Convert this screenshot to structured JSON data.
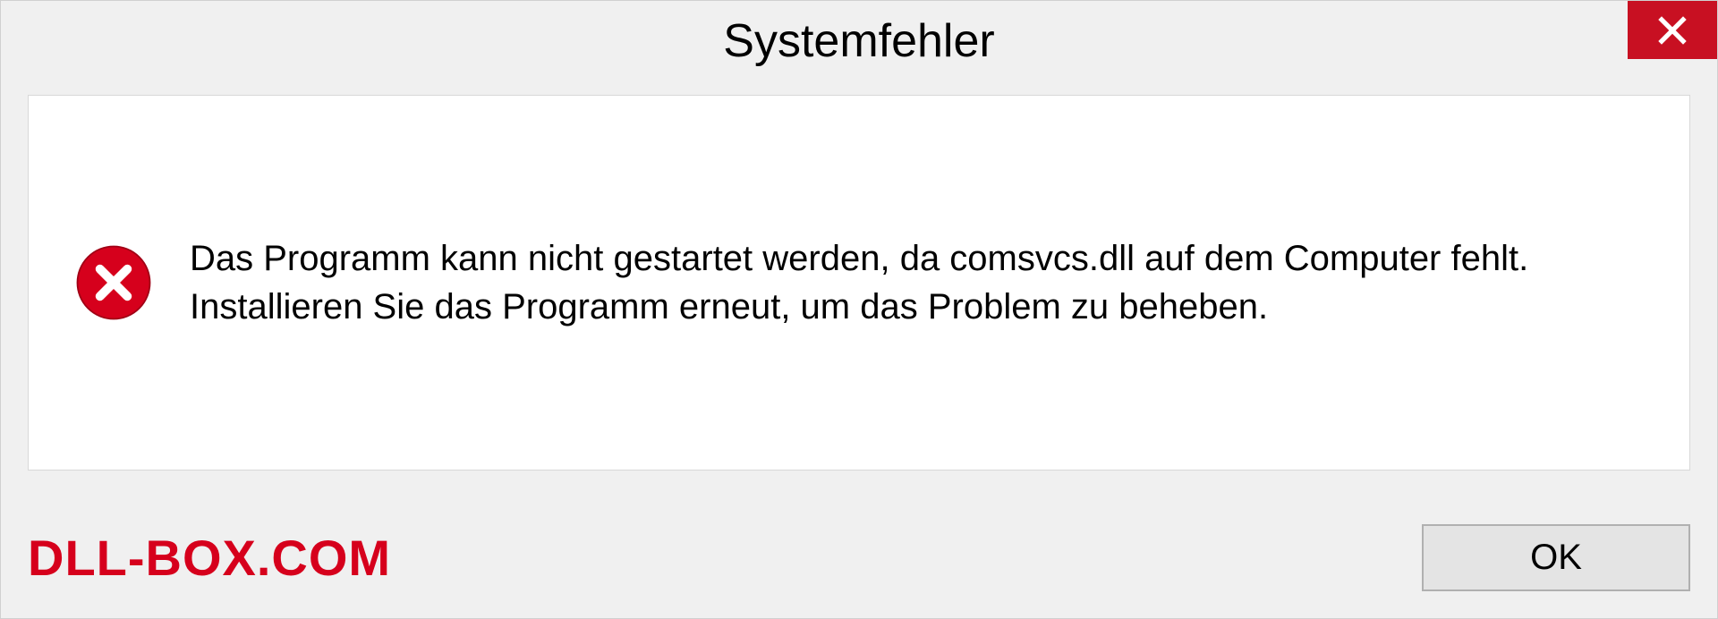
{
  "dialog": {
    "title": "Systemfehler",
    "message": "Das Programm kann nicht gestartet werden, da comsvcs.dll auf dem Computer fehlt. Installieren Sie das Programm erneut, um das Problem zu beheben.",
    "ok_label": "OK"
  },
  "watermark": "DLL-BOX.COM",
  "colors": {
    "error_red": "#c81022",
    "watermark_red": "#d6001c"
  }
}
